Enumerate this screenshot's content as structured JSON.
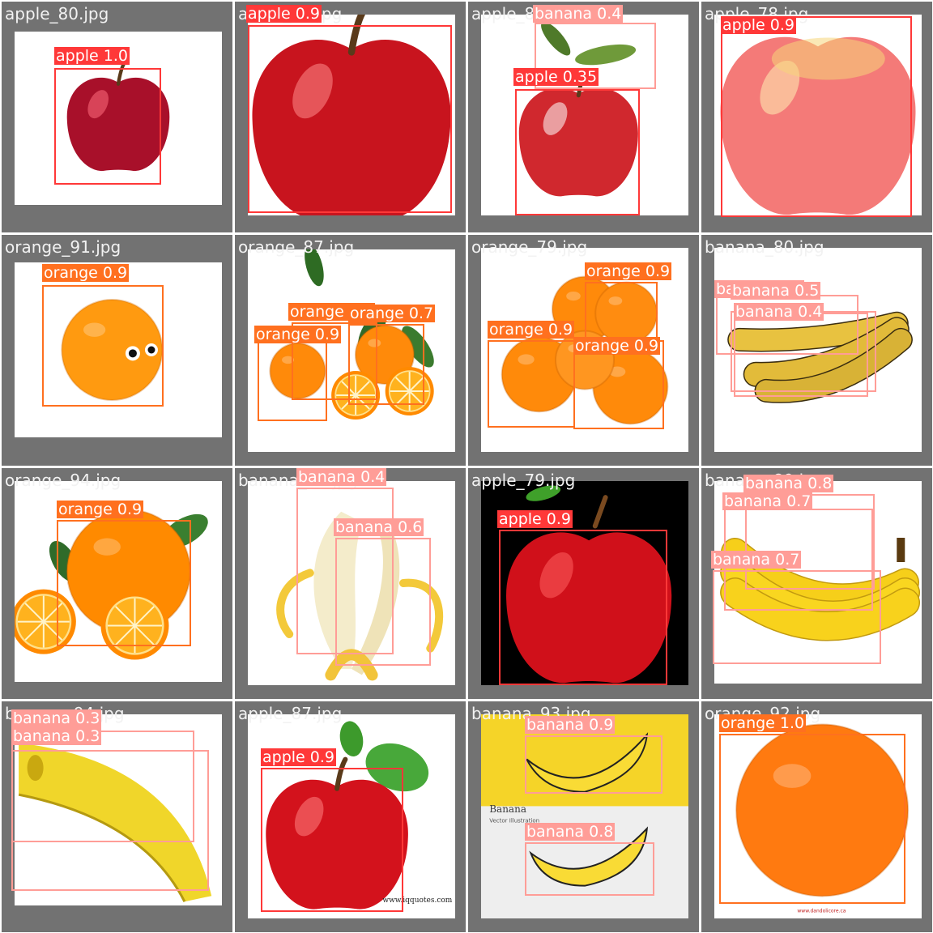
{
  "colors": {
    "apple": "#ff3838",
    "orange": "#ff701f",
    "banana": "#ff9d97"
  },
  "tiles": [
    {
      "file": "apple_80.jpg",
      "photo": "apple-photo-dark-red",
      "dets": [
        {
          "cls": "apple",
          "label": "apple 1.0"
        }
      ]
    },
    {
      "file": "apple_81.jpg",
      "photo": "apple-photo-red",
      "dets": [
        {
          "cls": "apple",
          "label": "apple 0.9"
        }
      ]
    },
    {
      "file": "apple_82.jpg",
      "photo": "apple-drawing",
      "dets": [
        {
          "cls": "banana",
          "label": "banana 0.4"
        },
        {
          "cls": "apple",
          "label": "apple 0.35"
        }
      ]
    },
    {
      "file": "apple_78.jpg",
      "photo": "apple-photo-pink",
      "dets": [
        {
          "cls": "apple",
          "label": "apple 0.9"
        }
      ]
    },
    {
      "file": "orange_91.jpg",
      "photo": "orange-cartoon-eyes",
      "dets": [
        {
          "cls": "orange",
          "label": "orange 0.9"
        }
      ]
    },
    {
      "file": "orange_87.jpg",
      "photo": "orange-halves-photo",
      "dets": [
        {
          "cls": "orange",
          "label": "orange 0.5"
        },
        {
          "cls": "orange",
          "label": "orange 0.7"
        },
        {
          "cls": "orange",
          "label": "orange 0.9"
        }
      ]
    },
    {
      "file": "orange_79.jpg",
      "photo": "tangerine-pile-photo",
      "dets": [
        {
          "cls": "orange",
          "label": "orange 0.9"
        },
        {
          "cls": "orange",
          "label": "orange 0.9"
        },
        {
          "cls": "orange",
          "label": "orange 0.9"
        }
      ]
    },
    {
      "file": "banana_80.jpg",
      "photo": "banana-ripe-bunch",
      "dets": [
        {
          "cls": "banana",
          "label": "banana 0.5"
        },
        {
          "cls": "banana",
          "label": "banana 0.4"
        },
        {
          "cls": "banana",
          "label": "banana 0.5"
        }
      ]
    },
    {
      "file": "orange_94.jpg",
      "photo": "orange-leaves-slices",
      "dets": [
        {
          "cls": "orange",
          "label": "orange 0.9"
        }
      ]
    },
    {
      "file": "banana_81.jpg",
      "photo": "banana-peeled-photo",
      "dets": [
        {
          "cls": "banana",
          "label": "banana 0.4"
        },
        {
          "cls": "banana",
          "label": "banana 0.6"
        }
      ]
    },
    {
      "file": "apple_79.jpg",
      "photo": "apple-on-black",
      "dets": [
        {
          "cls": "apple",
          "label": "apple 0.9"
        }
      ]
    },
    {
      "file": "banana_89.jpg",
      "photo": "banana-yellow-bunch",
      "dets": [
        {
          "cls": "banana",
          "label": "banana 0.8"
        },
        {
          "cls": "banana",
          "label": "banana 0.7"
        },
        {
          "cls": "banana",
          "label": "banana 0.7"
        }
      ]
    },
    {
      "file": "banana_94.jpg",
      "photo": "banana-single-closeup",
      "dets": [
        {
          "cls": "banana",
          "label": "banana 0.3"
        },
        {
          "cls": "banana",
          "label": "banana 0.3"
        }
      ]
    },
    {
      "file": "apple_87.jpg",
      "photo": "apple-with-leaves",
      "caption": "www.iqquotes.com",
      "dets": [
        {
          "cls": "apple",
          "label": "apple 0.9"
        }
      ]
    },
    {
      "file": "banana_93.jpg",
      "photo": "banana-vector-illustration",
      "caption": "Banana",
      "caption2": "Vector Illustration",
      "dets": [
        {
          "cls": "banana",
          "label": "banana 0.9"
        },
        {
          "cls": "banana",
          "label": "banana 0.8"
        }
      ]
    },
    {
      "file": "orange_92.jpg",
      "photo": "orange-whole-photo",
      "caption": "www.dandolicore.ca",
      "dets": [
        {
          "cls": "orange",
          "label": "orange 1.0"
        }
      ]
    }
  ]
}
